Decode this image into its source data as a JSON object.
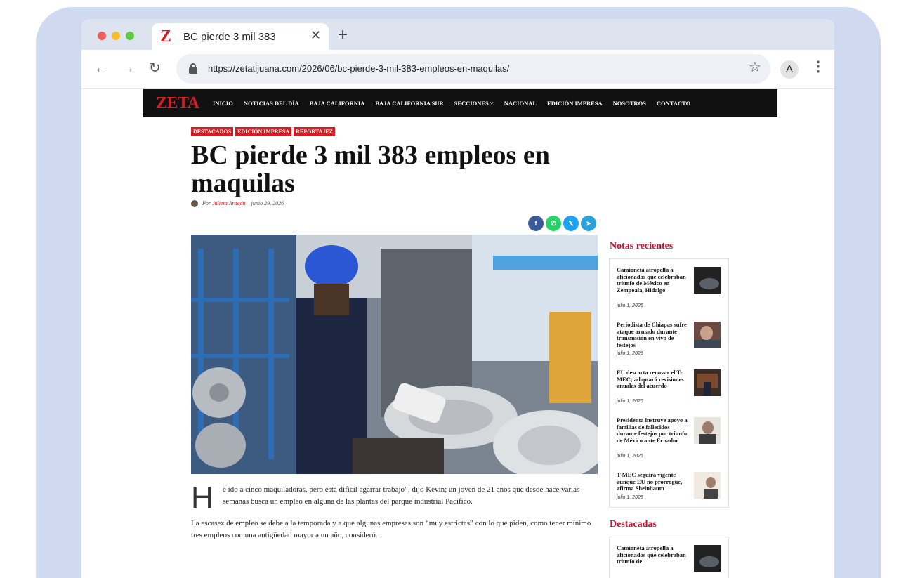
{
  "browser": {
    "tab_title": "BC pierde 3 mil 383",
    "tab_favicon": "Z",
    "new_tab": "+",
    "close_tab": "✕",
    "url": "https://zetatijuana.com/2026/06/bc-pierde-3-mil-383-empleos-en-maquilas/",
    "profile_initial": "A"
  },
  "site": {
    "logo": "ZETA",
    "menu": [
      "INICIO",
      "NOTICIAS DEL DÍA",
      "BAJA CALIFORNIA",
      "BAJA CALIFORNIA SUR",
      "SECCIONES ˅",
      "NACIONAL",
      "EDICIÓN IMPRESA",
      "NOSOTROS",
      "CONTACTO"
    ]
  },
  "article": {
    "categories": [
      "DESTACADOS",
      "EDICIÓN IMPRESA",
      "REPORTAJEZ"
    ],
    "title": "BC pierde 3 mil 383 empleos en maquilas",
    "by_prefix": "Por",
    "author": "Julieta Aragón",
    "date": "junio 29, 2026",
    "share_icons": [
      "facebook-icon",
      "whatsapp-icon",
      "x-icon",
      "telegram-icon"
    ],
    "dropcap": "H",
    "paragraph_1": "e ido a cinco maquiladoras, pero está difícil agarrar trabajo”, dijo Kevin; un joven de 21 años que desde hace varias semanas busca un empleo en alguna de las plantas del parque industrial Pacífico.",
    "paragraph_2": "La escasez de empleo se debe a la temporada y a que algunas empresas son “muy estrictas” con lo que piden, como tener mínimo tres empleos con una antigüedad mayor a un año, consideró."
  },
  "sidebar": {
    "recent_heading": "Notas recientes",
    "recent": [
      {
        "title": "Camioneta atropella a aficionados que celebraban triunfo de México en Zempoala, Hidalgo",
        "date": "julio 1, 2026"
      },
      {
        "title": "Periodista de Chiapas sufre ataque armado durante transmisión en vivo de festejos",
        "date": "julio 1, 2026"
      },
      {
        "title": "EU descarta renovar el T-MEC; adoptará revisiones anuales del acuerdo",
        "date": "julio 1, 2026"
      },
      {
        "title": "Presidenta instruye apoyo a familias de fallecidos durante festejos por triunfo de México ante Ecuador",
        "date": "julio 1, 2026"
      },
      {
        "title": "T-MEC seguirá vigente aunque EU no prorrogue, afirma Sheinbaum",
        "date": "julio 1, 2026"
      }
    ],
    "featured_heading": "Destacadas",
    "featured": [
      {
        "title": "Camioneta atropella a aficionados que celebraban triunfo de"
      }
    ]
  }
}
